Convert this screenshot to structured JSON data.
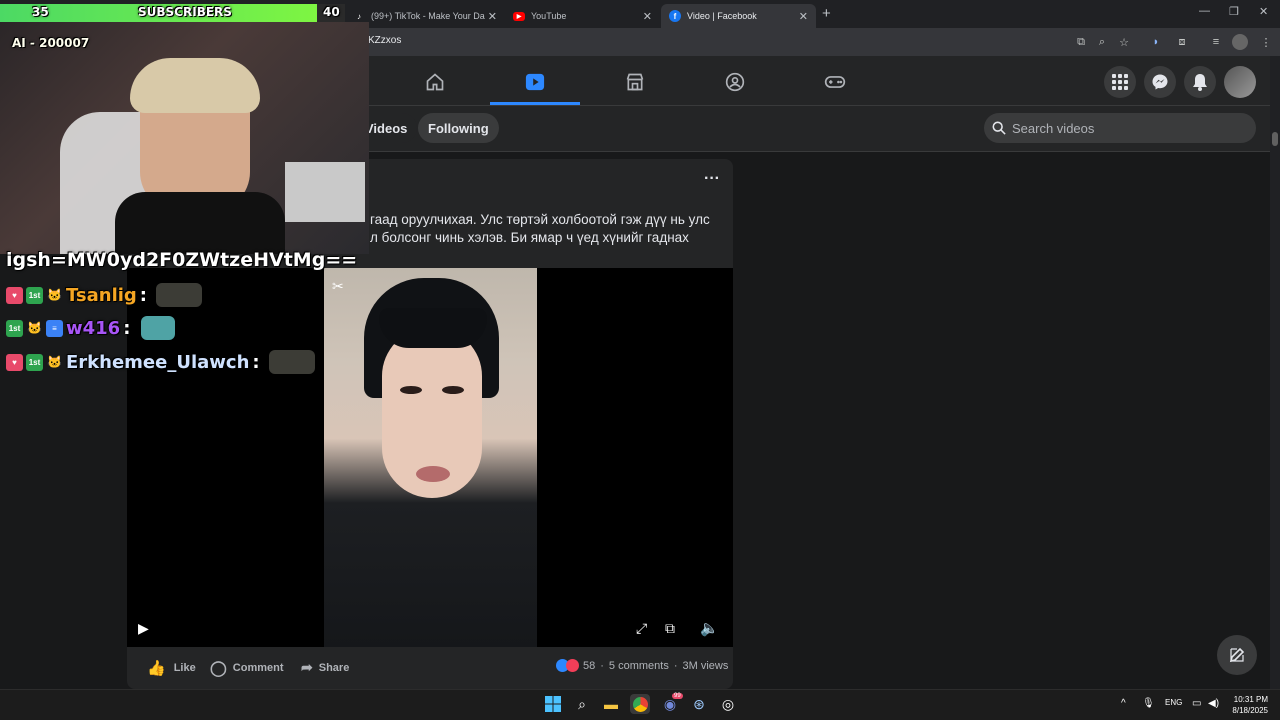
{
  "stream": {
    "subs_current": "35",
    "subs_label": "SUBSCRIBERS",
    "subs_goal": "40",
    "subs_progress": 0.92,
    "donation": "AI - 200007",
    "chat_link": "igsh=MW0yd2F0ZWtzeHVtMg==",
    "chat": [
      {
        "name": "Tsanlig",
        "color": "#f5a623"
      },
      {
        "name": "w416",
        "color": "#a855f7"
      },
      {
        "name": "Erkhemee_Ulawch",
        "color": "#cfe2ff"
      }
    ]
  },
  "browser": {
    "tabs": [
      {
        "label": "(99+) TikTok - Make Your Da",
        "icon": "tiktok-icon"
      },
      {
        "label": "YouTube",
        "icon": "youtube-icon"
      },
      {
        "label": "Video | Facebook",
        "icon": "facebook-icon",
        "active": true
      }
    ],
    "url_fragment": "KZzxos"
  },
  "facebook": {
    "subtabs": [
      "Videos",
      "Following"
    ],
    "search_placeholder": "Search videos",
    "post": {
      "text_line1": "гаад оруулчихая. Улс төртэй холбоотой гэж дүү нь улс",
      "text_line2": "л болсонг чинь хэлэв. Би ямар ч үед хүнийг гаднах",
      "reactions_count": "58",
      "comments": "5 comments",
      "views": "3M views"
    },
    "actions": {
      "like": "Like",
      "comment": "Comment",
      "share": "Share"
    }
  },
  "taskbar": {
    "lang": "ENG",
    "time": "10:31 PM",
    "date": "8/18/2025",
    "discord_badge": "99"
  },
  "colors": {
    "fb_accent": "#2d88ff",
    "subs_green": "#4cd964"
  }
}
